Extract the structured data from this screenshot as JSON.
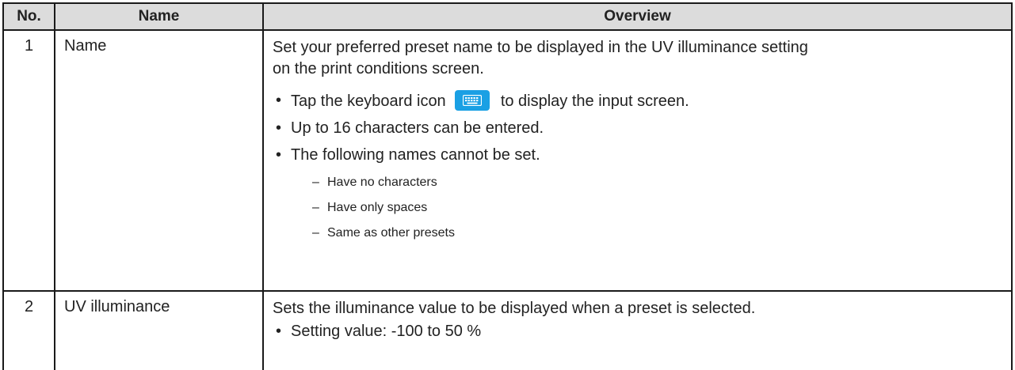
{
  "table": {
    "headers": [
      "No.",
      "Name",
      "Overview"
    ],
    "row1": {
      "no": "1",
      "name": "Name",
      "overview_line1": "Set your preferred preset name to be displayed in the UV illuminance setting",
      "overview_line2": "on the print conditions screen.",
      "bullet1_before": "Tap the keyboard icon",
      "bullet1_after": "to display the input screen.",
      "bullet2": "Up to 16 characters can be entered.",
      "bullet3": "The following names cannot be set.",
      "sub_items": [
        "Have no characters",
        "Have only spaces",
        "Same as other presets"
      ],
      "icon": "keyboard-icon",
      "icon_color": "#1aa0e4"
    },
    "row2": {
      "no": "2",
      "name": "UV illuminance",
      "overview": "Sets the illuminance value to be displayed when a preset is selected.",
      "bullet1": "Setting value: -100 to 50 %"
    },
    "bullet_glyph": "•",
    "dash_glyph": "–",
    "header_bg": "#dcdcdc"
  }
}
